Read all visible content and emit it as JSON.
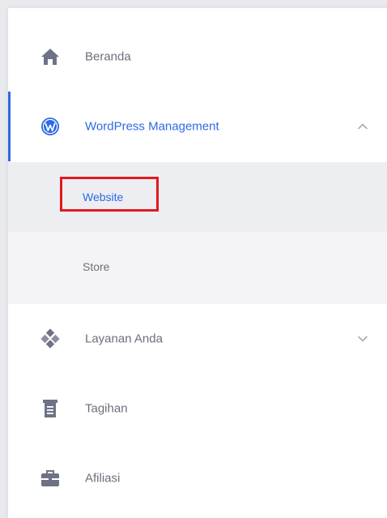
{
  "colors": {
    "accent": "#2d6ae3",
    "text_muted": "#6b6f7a",
    "icon": "#6e7287",
    "highlight_border": "#e3191d"
  },
  "menu": {
    "home": {
      "label": "Beranda",
      "icon": "home-icon"
    },
    "wordpress": {
      "label": "WordPress Management",
      "icon": "wordpress-icon",
      "expanded": true
    },
    "submenu": [
      {
        "label": "Website",
        "selected": true
      },
      {
        "label": "Store",
        "selected": false
      }
    ],
    "services": {
      "label": "Layanan Anda",
      "icon": "services-icon",
      "expanded": false
    },
    "billing": {
      "label": "Tagihan",
      "icon": "invoice-icon"
    },
    "affiliate": {
      "label": "Afiliasi",
      "icon": "briefcase-icon"
    }
  }
}
